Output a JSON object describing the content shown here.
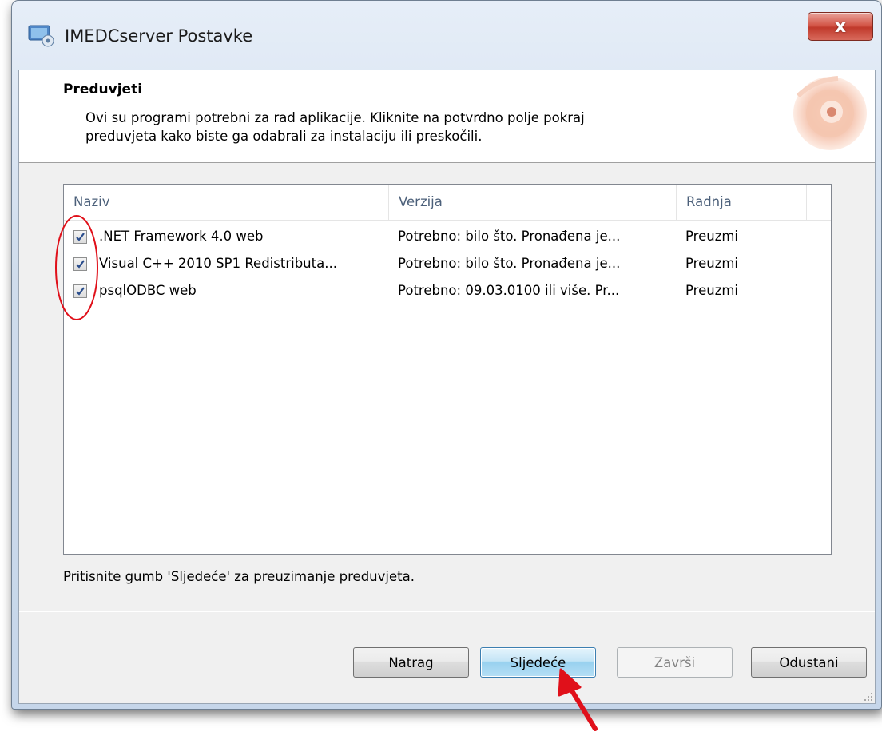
{
  "window": {
    "title": "IMEDCserver Postavke",
    "close_label": "x"
  },
  "header": {
    "title": "Preduvjeti",
    "description_line1": "Ovi su programi potrebni za rad aplikacije. Kliknite na potvrdno polje pokraj",
    "description_line2": "preduvjeta kako biste ga odabrali za instalaciju ili preskočili."
  },
  "list": {
    "columns": [
      "Naziv",
      "Verzija",
      "Radnja"
    ],
    "rows": [
      {
        "checked": true,
        "name": ".NET Framework 4.0 web",
        "version": "Potrebno: bilo što. Pronađena je...",
        "action": "Preuzmi"
      },
      {
        "checked": true,
        "name": "Visual C++ 2010 SP1 Redistributa...",
        "version": "Potrebno: bilo što. Pronađena je...",
        "action": "Preuzmi"
      },
      {
        "checked": true,
        "name": "psqlODBC web",
        "version": "Potrebno: 09.03.0100 ili više. Pr...",
        "action": "Preuzmi"
      }
    ]
  },
  "footer_text": "Pritisnite gumb 'Sljedeće' za preuzimanje preduvjeta.",
  "buttons": {
    "back": "Natrag",
    "next": "Sljedeće",
    "finish": "Završi",
    "cancel": "Odustani"
  },
  "colors": {
    "annotation_red": "#e0101a",
    "accent_blue": "#3c7fb1"
  }
}
